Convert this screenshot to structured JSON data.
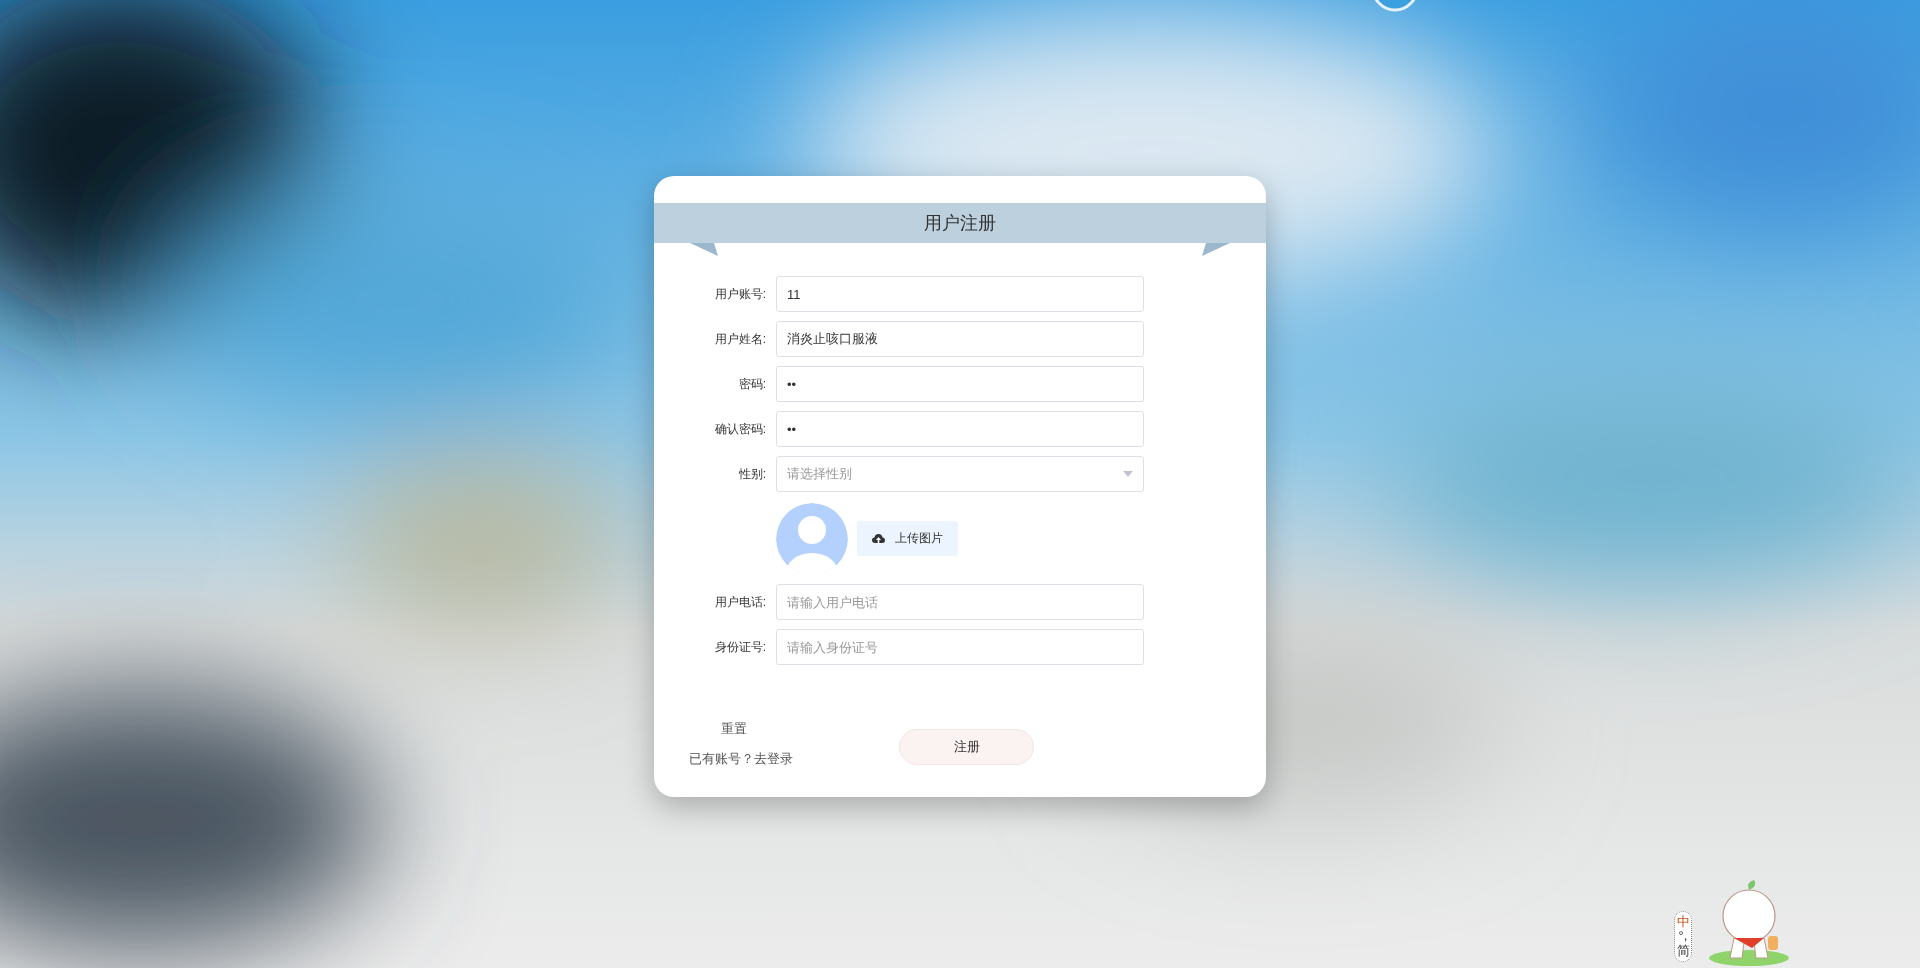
{
  "form": {
    "title": "用户注册",
    "fields": [
      {
        "kind": "input",
        "label": "用户账号:",
        "value": "11"
      },
      {
        "kind": "input",
        "label": "用户姓名:",
        "value": "消炎止咳口服液"
      },
      {
        "kind": "input",
        "label": "密码:",
        "value": "••"
      },
      {
        "kind": "input",
        "label": "确认密码:",
        "value": "••"
      },
      {
        "kind": "select",
        "label": "性别:",
        "placeholder": "请选择性别"
      },
      {
        "kind": "avatar",
        "button": "上传图片"
      },
      {
        "kind": "input",
        "label": "用户电话:",
        "placeholder": "请输入用户电话"
      },
      {
        "kind": "input",
        "label": "身份证号:",
        "placeholder": "请输入身份证号"
      }
    ],
    "reset": "重置",
    "login_prompt": "已有账号？去登录",
    "submit": "注册"
  },
  "ime": {
    "mode": "中",
    "punct": "°,",
    "script": "简"
  }
}
